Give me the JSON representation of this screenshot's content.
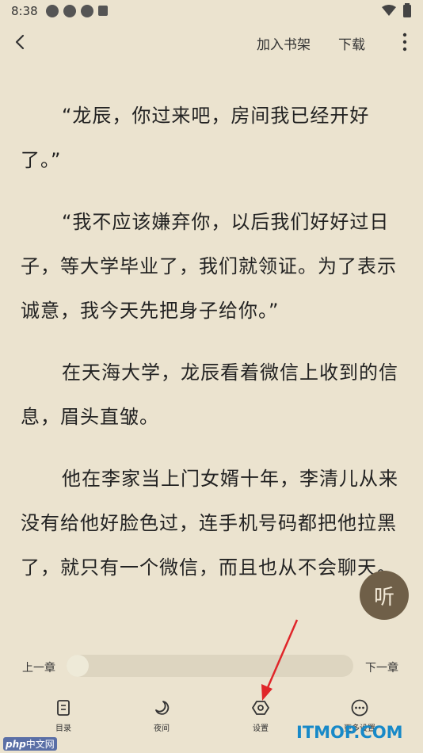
{
  "status_bar": {
    "time": "8:38"
  },
  "top_bar": {
    "add_to_shelf": "加入书架",
    "download": "下载"
  },
  "paragraphs": [
    "“龙辰，你过来吧，房间我已经开好了。”",
    "“我不应该嫌弃你，以后我们好好过日子，等大学毕业了，我们就领证。为了表示诚意，我今天先把身子给你。”",
    "在天海大学，龙辰看着微信上收到的信息，眉头直皱。",
    "他在李家当上门女婿十年，李清儿从来没有给他好脸色过，连手机号码都把他拉黑了，就只有一个微信，而且也从不会聊天。"
  ],
  "listen_button": {
    "label": "听"
  },
  "chapter_nav": {
    "prev": "上一章",
    "next": "下一章",
    "progress": 0
  },
  "toolbar": {
    "items": [
      {
        "label": "目录",
        "icon": "catalog-icon"
      },
      {
        "label": "夜间",
        "icon": "moon-icon"
      },
      {
        "label": "设置",
        "icon": "settings-icon"
      },
      {
        "label": "更多设置",
        "icon": "more-icon"
      }
    ]
  },
  "watermarks": {
    "itmop": "ITMOP.COM",
    "php": "php",
    "php_cn": "中文网"
  },
  "colors": {
    "background": "#ebe3cf",
    "listen_button": "#6f5f48",
    "arrow": "#e0262a",
    "watermark": "#1789c8"
  }
}
